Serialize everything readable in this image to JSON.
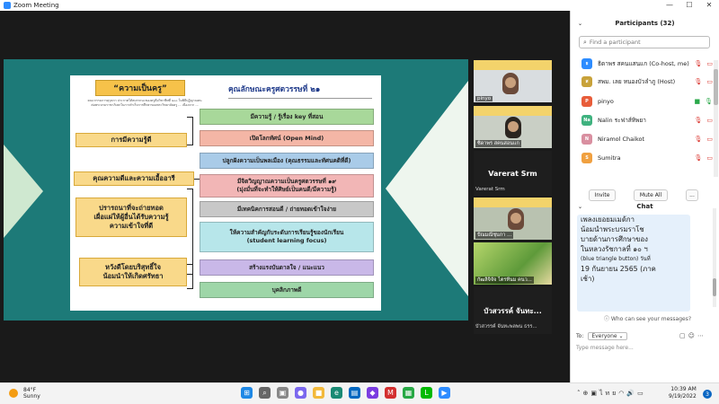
{
  "window": {
    "title": "Zoom Meeting",
    "controls": [
      "—",
      "☐",
      "✕"
    ]
  },
  "slide": {
    "title": "“ความเป็นครู”",
    "small_text": "คณะกรรมการคุรุสภา ประกาศให้สมรรถนะของครูคือวิชาชีพที่ ๑๐๐ ในพิธีปฏิญาณตนต่อพระบรมราชาภิเษกในการสำเร็จการศึกษาของพระวิทยาลัยครู ... เนื่องจาก ...",
    "heading": "คุณลักษณะครูศตวรรษที่ ๒๑",
    "left_boxes": [
      "การมีความรู้ดี",
      "คุณความดีและความเอื้ออารี",
      "ปรารถนาที่จะถ่ายทอด\nเผื่อแผ่ให้ผู้อื่นได้รับความรู้\nความเข้าใจที่ดี",
      "หวังดีโดยบริสุทธิ์ใจ\nน้อมนำให้เกิดศรัทธา"
    ],
    "right_boxes": [
      "มีความรู้ / รู้เรื่อง key ที่สอน",
      "เปิดโลกทัศน์ (Open Mind)",
      "ปลูกฝังความเป็นพลเมือง (คุณธรรมและทัศนคติที่ดี)",
      "มีจิตวิญญาณความเป็นครูศตวรรษที่ ๑๙\n(มุ่งมั่นที่จะทำให้ศิษย์เป็นคนดี/มีความรู้)",
      "มีเทคนิคการสอนดี / ถ่ายทอดเข้าใจง่าย",
      "ให้ความสำคัญกับระดับการเรียนรู้ของนักเรียน\n(student learning focus)",
      "สร้างแรงบันดาลใจ / แนะแนว",
      "บุคลิกภาพดี"
    ],
    "right_colors": [
      "#a8d89a",
      "#f4b6a6",
      "#a9cbe8",
      "#f2b6b6",
      "#c8c8c8",
      "#b7e6ea",
      "#c9b8e8",
      "#9ed6a8"
    ]
  },
  "thumbnails": [
    {
      "caption": "pinyo"
    },
    {
      "caption": "ซิดาพร สคนสอนแก"
    },
    {
      "caption": "ปัณมณีชุบภา ..."
    },
    {
      "caption": "กัฒลิจิจัจ ไตรทีนม คนว..."
    }
  ],
  "namecards": [
    {
      "big": "Varerat Srm",
      "small": "Varerat Srm"
    },
    {
      "big": "บัวสวรรค์ จันทะ...",
      "small": "บัวสวรรค์ จันทะพลพน ธรร..."
    }
  ],
  "participants": {
    "header": "Participants (32)",
    "search_placeholder": "Find a participant",
    "list": [
      {
        "initial": "ธ",
        "color": "#2d8cff",
        "name": "ธิดาพร สคนแสนแก (Co-host, me)"
      },
      {
        "initial": "ส",
        "color": "#c8a23a",
        "name": "สพม. เลย หนองบัวลำภู (Host)"
      },
      {
        "initial": "P",
        "color": "#e85d3a",
        "name": "pinyo"
      },
      {
        "initial": "Na",
        "color": "#3fb27f",
        "name": "Nalin ระฟาส์ทิพยา"
      },
      {
        "initial": "N",
        "color": "#d98fa0",
        "name": "Niramol Chaikot"
      },
      {
        "initial": "S",
        "color": "#f0a040",
        "name": "Sumitra"
      }
    ],
    "buttons": [
      "Invite",
      "Mute All",
      "..."
    ]
  },
  "chat": {
    "header": "Chat",
    "message_lines": [
      "เพลงเยอยมเมด้กา",
      "น้อมนำพระบรมราโช",
      "บายด้านการศึกษาของ",
      "ในหลวงรัชกาลที่ ๑๐ ฯ",
      "(blue triangle button) วันที่",
      "19 กันยายน 2565 (ภาค",
      "เช้า)"
    ],
    "who_can_see": "Who can see your messages?",
    "to_label": "To:",
    "to_value": "Everyone",
    "message_placeholder": "Type message here..."
  },
  "taskbar": {
    "temp": "84°F",
    "weather": "Sunny",
    "lang": "ไทย",
    "time": "10:39 AM",
    "date": "9/19/2022",
    "notif_count": "3"
  }
}
